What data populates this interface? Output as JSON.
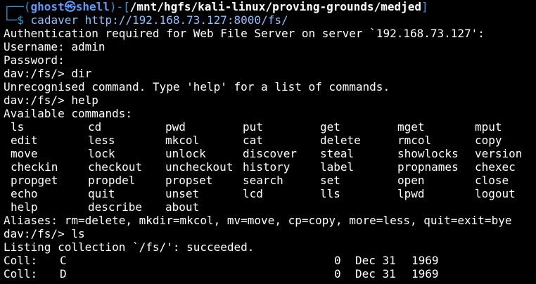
{
  "prompt": {
    "frame_top": "┌──(",
    "user_host": "ghost㉿shell",
    "frame_mid": ")-[",
    "cwd": "/mnt/hgfs/kali-linux/proving-grounds/medjed",
    "frame_end": "]",
    "frame_bottom": "└─$",
    "command": "cadaver http://192.168.73.127:8000/fs/"
  },
  "output_pre": [
    "Authentication required for Web File Server on server `192.168.73.127':",
    "Username: admin",
    "Password:",
    "dav:/fs/> dir",
    "Unrecognised command. Type 'help' for a list of commands.",
    "dav:/fs/> help",
    "Available commands:"
  ],
  "commands": [
    [
      "ls",
      "cd",
      "pwd",
      "put",
      "get",
      "mget",
      "mput"
    ],
    [
      "edit",
      "less",
      "mkcol",
      "cat",
      "delete",
      "rmcol",
      "copy"
    ],
    [
      "move",
      "lock",
      "unlock",
      "discover",
      "steal",
      "showlocks",
      "version"
    ],
    [
      "checkin",
      "checkout",
      "uncheckout",
      "history",
      "label",
      "propnames",
      "chexec"
    ],
    [
      "propget",
      "propdel",
      "propset",
      "search",
      "set",
      "open",
      "close"
    ],
    [
      "echo",
      "quit",
      "unset",
      "lcd",
      "lls",
      "lpwd",
      "logout"
    ],
    [
      "help",
      "describe",
      "about"
    ]
  ],
  "output_post": [
    "Aliases: rm=delete, mkdir=mkcol, mv=move, cp=copy, more=less, quit=exit=bye",
    "dav:/fs/> ls",
    "Listing collection `/fs/': succeeded."
  ],
  "listing": [
    {
      "type": "Coll:",
      "name": "C",
      "size": "0",
      "date": "Dec 31",
      "year": "1969"
    },
    {
      "type": "Coll:",
      "name": "D",
      "size": "0",
      "date": "Dec 31",
      "year": "1969"
    }
  ],
  "colors": {
    "background": "#000000",
    "frame": "#2f9bd8",
    "user": "#5b9bff",
    "text": "#ffffff"
  }
}
